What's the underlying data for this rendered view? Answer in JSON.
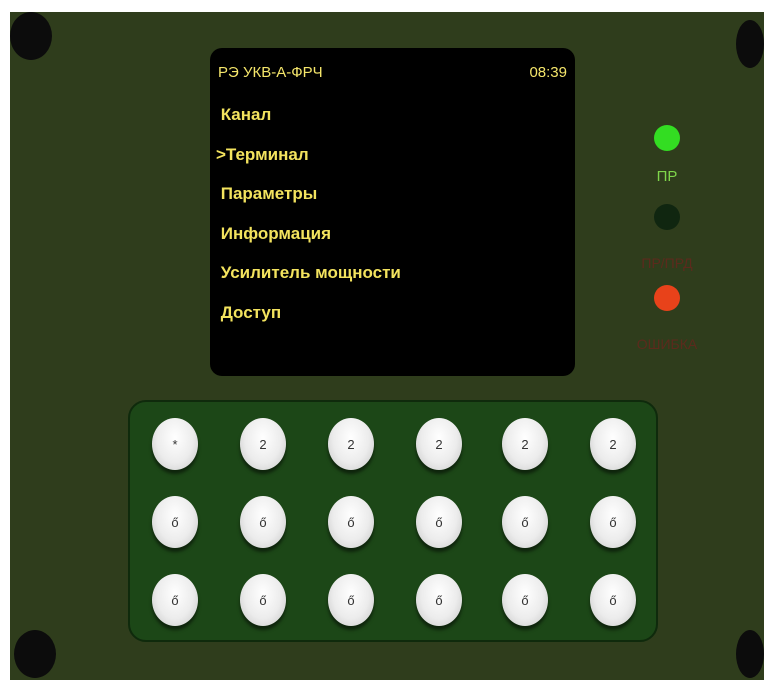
{
  "screen": {
    "title": "РЭ УКВ-А-ФРЧ",
    "time": "08:39",
    "menu": [
      " Канал",
      ">Терминал",
      " Параметры",
      " Информация",
      " Усилитель мощности",
      " Доступ"
    ]
  },
  "indicators": [
    {
      "label": "ПР",
      "color": "#33dd22",
      "label_color": "#7fd64a"
    },
    {
      "label": "ПР/ПРД",
      "color": "#102610",
      "label_color": "#5c2a1c"
    },
    {
      "label": "ОШИБКА",
      "color": "#e8421a",
      "label_color": "#5c2a1c"
    }
  ],
  "keypad": {
    "rows": [
      [
        "*",
        "2",
        "2",
        "2",
        "2",
        "2"
      ],
      [
        "ő",
        "ő",
        "ő",
        "ő",
        "ő",
        "ő"
      ],
      [
        "ő",
        "ő",
        "ő",
        "ő",
        "ő",
        "ő"
      ]
    ]
  }
}
